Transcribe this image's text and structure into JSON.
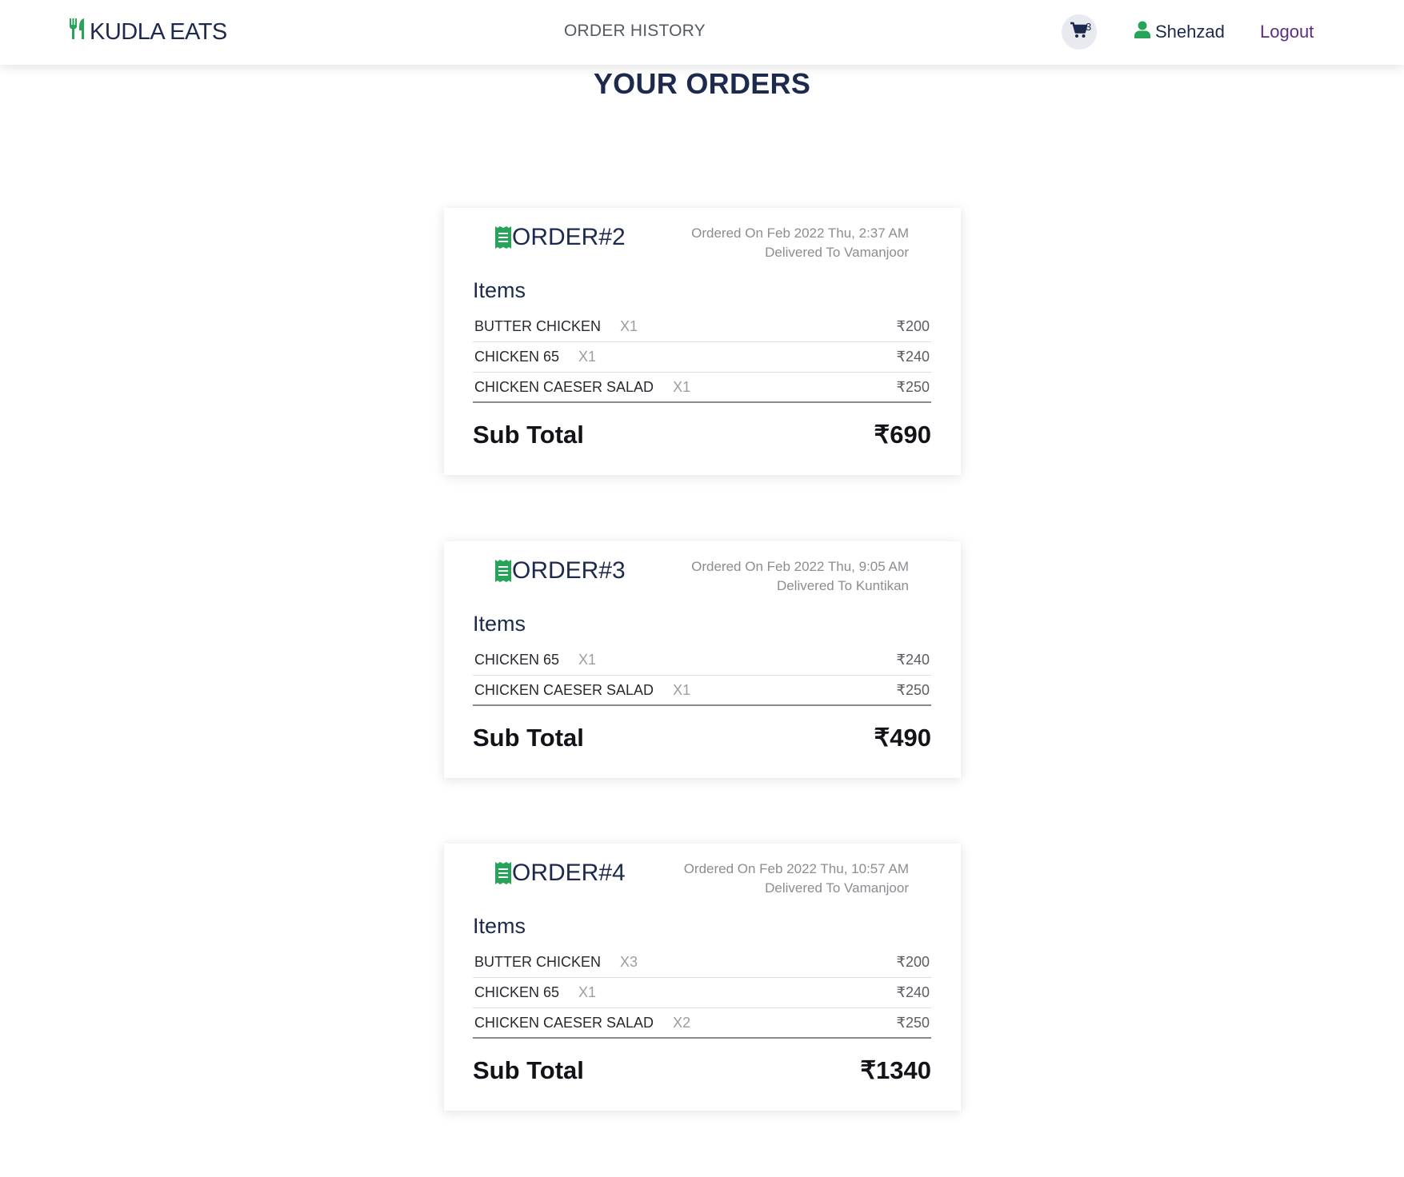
{
  "navbar": {
    "brand": "KUDLA EATS",
    "center_link": "ORDER HISTORY",
    "cart_count": "3",
    "user_name": "Shehzad",
    "logout_label": "Logout"
  },
  "page_title": "YOUR ORDERS",
  "colors": {
    "accent_green": "#27a35a",
    "navy": "#1d2a4d",
    "logout_purple": "#5a2d82"
  },
  "icons": [
    "utensils-icon",
    "cart-icon",
    "user-icon",
    "receipt-icon"
  ],
  "labels": {
    "items": "Items",
    "subtotal": "Sub Total"
  },
  "orders": [
    {
      "id": "ORDER#2",
      "ordered_on": "Ordered On Feb 2022 Thu, 2:37 AM",
      "delivered_to": "Delivered To Vamanjoor",
      "items": [
        {
          "name": "BUTTER CHICKEN",
          "qty": "X1",
          "price": "₹200"
        },
        {
          "name": "CHICKEN 65",
          "qty": "X1",
          "price": "₹240"
        },
        {
          "name": "CHICKEN CAESER SALAD",
          "qty": "X1",
          "price": "₹250"
        }
      ],
      "subtotal": "₹690"
    },
    {
      "id": "ORDER#3",
      "ordered_on": "Ordered On Feb 2022 Thu, 9:05 AM",
      "delivered_to": "Delivered To Kuntikan",
      "items": [
        {
          "name": "CHICKEN 65",
          "qty": "X1",
          "price": "₹240"
        },
        {
          "name": "CHICKEN CAESER SALAD",
          "qty": "X1",
          "price": "₹250"
        }
      ],
      "subtotal": "₹490"
    },
    {
      "id": "ORDER#4",
      "ordered_on": "Ordered On Feb 2022 Thu, 10:57 AM",
      "delivered_to": "Delivered To Vamanjoor",
      "items": [
        {
          "name": "BUTTER CHICKEN",
          "qty": "X3",
          "price": "₹200"
        },
        {
          "name": "CHICKEN 65",
          "qty": "X1",
          "price": "₹240"
        },
        {
          "name": "CHICKEN CAESER SALAD",
          "qty": "X2",
          "price": "₹250"
        }
      ],
      "subtotal": "₹1340"
    }
  ]
}
